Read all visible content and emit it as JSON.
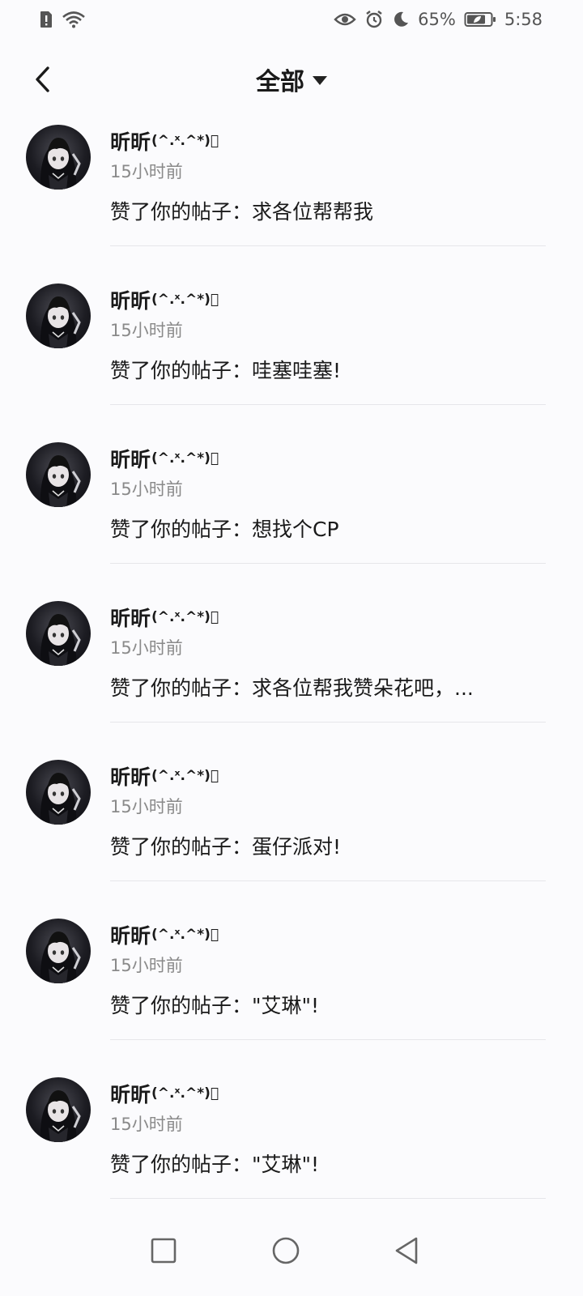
{
  "status_bar": {
    "battery_percent": "65%",
    "time": "5:58",
    "icons": [
      "sim-alert-icon",
      "wifi-icon",
      "eye-icon",
      "alarm-icon",
      "moon-icon",
      "battery-icon"
    ]
  },
  "header": {
    "title": "全部",
    "back_icon": "back-arrow-icon",
    "dropdown_icon": "caret-down-icon"
  },
  "notifications": [
    {
      "name": "昕昕",
      "emoticon": "(^.ˣ.^*)゙",
      "time": "15小时前",
      "content": "赞了你的帖子：求各位帮帮我"
    },
    {
      "name": "昕昕",
      "emoticon": "(^.ˣ.^*)゙",
      "time": "15小时前",
      "content": "赞了你的帖子：哇塞哇塞!"
    },
    {
      "name": "昕昕",
      "emoticon": "(^.ˣ.^*)゙",
      "time": "15小时前",
      "content": "赞了你的帖子：想找个CP"
    },
    {
      "name": "昕昕",
      "emoticon": "(^.ˣ.^*)゙",
      "time": "15小时前",
      "content": "赞了你的帖子：求各位帮我赞朵花吧，..."
    },
    {
      "name": "昕昕",
      "emoticon": "(^.ˣ.^*)゙",
      "time": "15小时前",
      "content": "赞了你的帖子：蛋仔派对!"
    },
    {
      "name": "昕昕",
      "emoticon": "(^.ˣ.^*)゙",
      "time": "15小时前",
      "content": "赞了你的帖子：\"艾琳\"!"
    },
    {
      "name": "昕昕",
      "emoticon": "(^.ˣ.^*)゙",
      "time": "15小时前",
      "content": "赞了你的帖子：\"艾琳\"!"
    }
  ],
  "nav_bar": {
    "icons": [
      "recents-square-icon",
      "home-circle-icon",
      "back-triangle-icon"
    ]
  }
}
